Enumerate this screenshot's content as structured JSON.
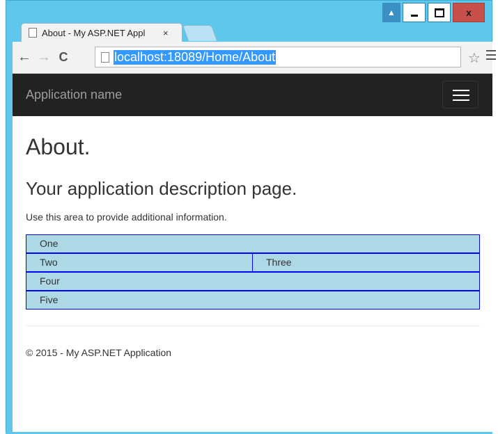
{
  "browser": {
    "tab_title": "About - My ASP.NET Appl",
    "tab_close": "×",
    "url": "localhost:18089/Home/About",
    "back_glyph": "←",
    "forward_glyph": "→",
    "reload_glyph": "C",
    "star_glyph": "☆",
    "close_glyph": "x",
    "user_glyph": "▲"
  },
  "navbar": {
    "brand": "Application name"
  },
  "page": {
    "title": "About.",
    "subtitle": "Your application description page.",
    "lead": "Use this area to provide additional information."
  },
  "grid": {
    "rows": [
      [
        "One"
      ],
      [
        "Two",
        "Three"
      ],
      [
        "Four"
      ],
      [
        "Five"
      ]
    ]
  },
  "footer": {
    "text": "© 2015 - My ASP.NET Application"
  },
  "colors": {
    "window_frame": "#5ec8ec",
    "navbar_bg": "#222222",
    "cell_bg": "#add8e6",
    "cell_border": "#0000ff",
    "url_highlight": "#3399ff"
  }
}
